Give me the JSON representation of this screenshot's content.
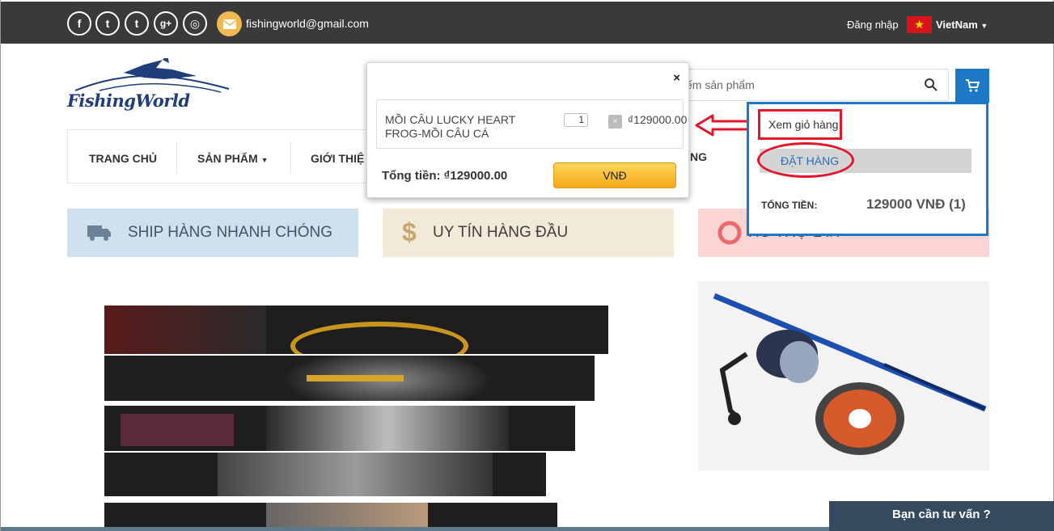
{
  "topbar": {
    "social": [
      {
        "name": "facebook-icon",
        "glyph": "f"
      },
      {
        "name": "twitter-icon",
        "glyph": "t"
      },
      {
        "name": "tumblr-icon",
        "glyph": "t"
      },
      {
        "name": "google-plus-icon",
        "glyph": "g+"
      },
      {
        "name": "dribbble-icon",
        "glyph": "◎"
      }
    ],
    "email": "fishingworld@gmail.com",
    "login_label": "Đăng nhập",
    "language": "VietNam"
  },
  "header": {
    "logo_text": "FishingWorld",
    "search_placeholder": "ếm sản phẩm"
  },
  "nav": {
    "items": [
      "TRANG CHỦ",
      "SẢN PHẨM",
      "GIỚI THIỆ"
    ],
    "tail_text": "NG"
  },
  "features": [
    {
      "icon": "truck-icon",
      "label": "SHIP HÀNG NHANH CHÓNG"
    },
    {
      "icon": "dollar-icon",
      "label": "UY TÍN HÀNG ĐẦU"
    },
    {
      "icon": "lifebuoy-icon",
      "label": "HỖ TRỢ 24/7"
    }
  ],
  "cart_popup": {
    "close_label": "×",
    "item_name": "MỒI CÂU LUCKY HEART FROG-MỒI CÂU CÁ",
    "item_qty": "1",
    "remove_label": "×",
    "item_price": "₫129000.00",
    "total_label": "Tổng tiền: ₫129000.00",
    "currency_button": "VNĐ"
  },
  "cart_dropdown": {
    "view_cart": "Xem giỏ hàng",
    "order": "ĐẶT HÀNG",
    "total_label": "TỔNG TIỀN:",
    "total_value": "129000 VNĐ (1)"
  },
  "chat": {
    "label": "Bạn cần tư vấn ?"
  },
  "colors": {
    "accent": "#1e78c8",
    "highlight": "#e3162b",
    "topbar": "#3a3a3a"
  }
}
